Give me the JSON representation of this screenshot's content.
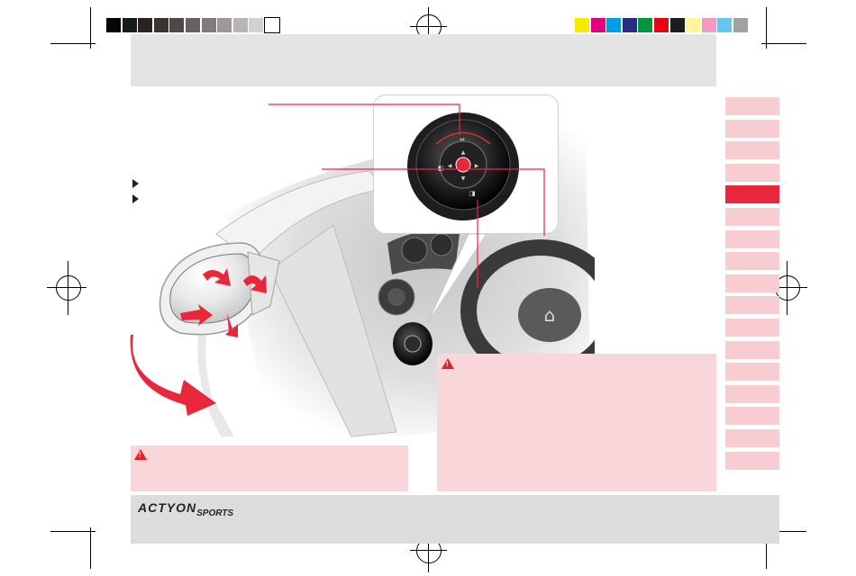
{
  "colors": {
    "accent": "#e8273a",
    "tab_inactive": "#f7cdd1",
    "warning_bg": "#f8d6da",
    "warning_icon": "#e2232a",
    "header_band": "#e4e4e4",
    "footer_band": "#dcdcdc"
  },
  "color_bar_left": [
    "#050505",
    "#1a1a1a",
    "#2b2221",
    "#3b3433",
    "#4e4948",
    "#676261",
    "#807c7b",
    "#9c9896",
    "#b7b4b3",
    "#d4d2d1",
    "#ffffff"
  ],
  "color_bar_right": [
    "#f5ea00",
    "#e5007e",
    "#009fe3",
    "#2a2c83",
    "#00963f",
    "#e30613",
    "#1d1d1b",
    "#fff59a",
    "#f49ac1",
    "#66c6f0",
    "#a2a2a2"
  ],
  "footer": {
    "logo_main": "ACTYON",
    "logo_sub": "SPORTS"
  },
  "warnings": {
    "icon_glyph": "!"
  },
  "tabs": {
    "count": 17,
    "active_index": 4
  },
  "illustration": {
    "subject": "side-mirror-adjustment",
    "icons": [
      "mirror-fold-icon",
      "left-mirror-icon",
      "right-mirror-icon",
      "adjust-joystick-icon"
    ]
  }
}
